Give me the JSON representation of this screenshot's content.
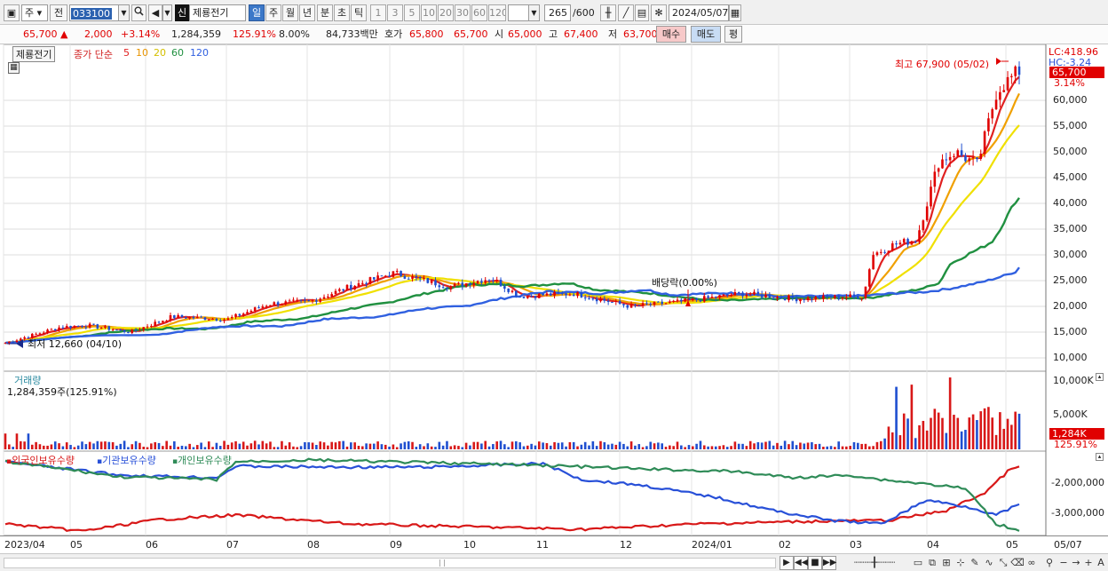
{
  "toolbar": {
    "market_select": "주",
    "prev_label": "전",
    "stock_code": "033100",
    "stock_name": "제룡전기",
    "badge": "신",
    "periods": [
      "일",
      "주",
      "월",
      "년",
      "분",
      "초",
      "틱"
    ],
    "active_period": "일",
    "intervals": [
      "1",
      "3",
      "5",
      "10",
      "20",
      "30",
      "60",
      "120"
    ],
    "count_value": "265",
    "count_max": "/600",
    "date_value": "2024/05/07"
  },
  "quote": {
    "price": "65,700",
    "change": "2,000",
    "change_pct": "+3.14%",
    "volume": "1,284,359",
    "volume_ratio": "125.91%",
    "turnover": "8.00%",
    "trade_amount": "84,733백만",
    "hoga_label": "호가",
    "ask": "65,800",
    "bid": "65,700",
    "open_label": "시",
    "open": "65,000",
    "high_label": "고",
    "high": "67,400",
    "low_label": "저",
    "low": "63,700",
    "buy_label": "매수",
    "sell_label": "매도",
    "eval_label": "평"
  },
  "price_pane": {
    "tag": "제룡전기",
    "legend_prefix": "종가 단순",
    "ma_periods": [
      "5",
      "10",
      "20",
      "60",
      "120"
    ],
    "ma_colors": [
      "#e02020",
      "#f0a000",
      "#f0e000",
      "#209040",
      "#3060e0"
    ],
    "lc_label": "LC:418.96",
    "hc_label": "HC:-3.24",
    "last_price_tag": "65,700",
    "last_pct_tag": "3.14%",
    "high_annot": "최고 67,900 (05/02)",
    "low_annot": "최저 12,660 (04/10)",
    "div_annot": "배당락(0.00%)",
    "y_ticks": [
      "60,000",
      "55,000",
      "50,000",
      "45,000",
      "40,000",
      "35,000",
      "30,000",
      "25,000",
      "20,000",
      "15,000",
      "10,000"
    ]
  },
  "volume_pane": {
    "title": "거래량",
    "value": "1,284,359주(125.91%)",
    "y_ticks": [
      "10,000K",
      "5,000K"
    ],
    "last_tag": "1,284K",
    "last_pct": "125.91%"
  },
  "holdings_pane": {
    "legends": [
      "외국인보유수량",
      "기관보유수량",
      "개인보유수량"
    ],
    "colors": [
      "#d81818",
      "#2850d8",
      "#2e8b57"
    ],
    "y_ticks": [
      "-2,000,000",
      "-3,000,000"
    ]
  },
  "x_axis": [
    "2023/04",
    "05",
    "06",
    "07",
    "08",
    "09",
    "10",
    "11",
    "12",
    "2024/01",
    "02",
    "03",
    "04",
    "05",
    "05/07"
  ]
}
